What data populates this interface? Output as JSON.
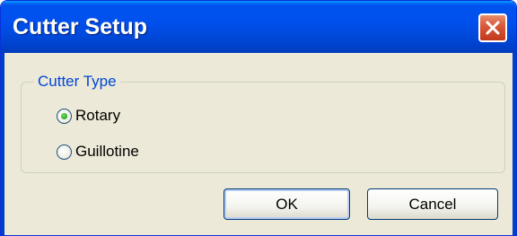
{
  "window": {
    "title": "Cutter Setup",
    "close_icon": "close-icon"
  },
  "cutter_type": {
    "legend": "Cutter Type",
    "options": [
      {
        "label": "Rotary",
        "selected": true
      },
      {
        "label": "Guillotine",
        "selected": false
      }
    ]
  },
  "buttons": {
    "ok_label": "OK",
    "cancel_label": "Cancel"
  },
  "colors": {
    "titlebar": "#0050ee",
    "close_button": "#d95b3b",
    "dialog_background": "#ece9d8",
    "legend_text": "#0046d5",
    "radio_selected_dot": "#21a121"
  }
}
